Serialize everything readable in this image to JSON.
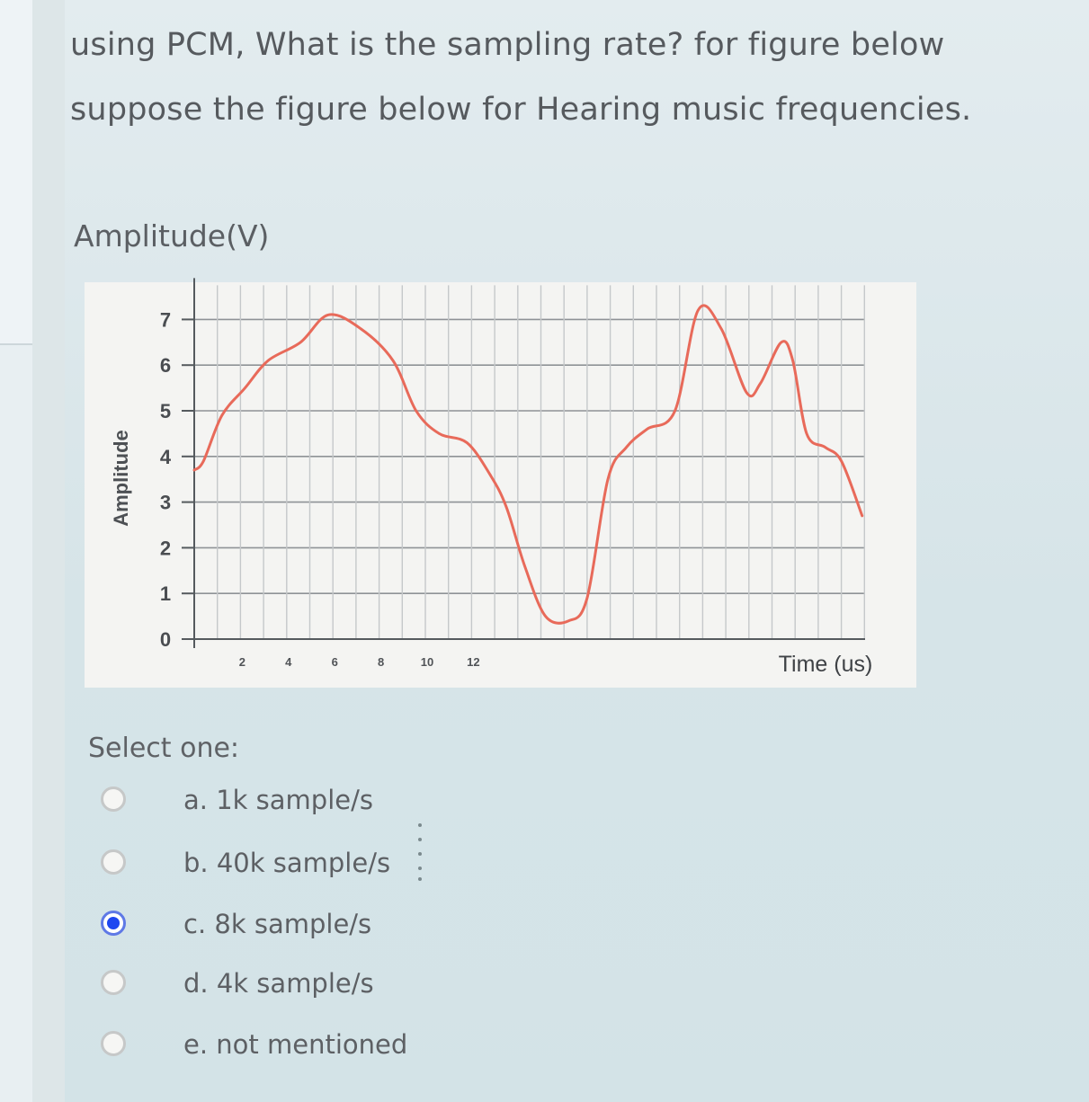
{
  "question": {
    "line1": "using PCM, What is the sampling rate? for figure below",
    "line2": "suppose the figure below for Hearing music frequencies."
  },
  "figure_heading": "Amplitude(V)",
  "chart_data": {
    "type": "line",
    "ylabel": "Amplitude",
    "xlabel": "Time (us)",
    "ylim": [
      0,
      7
    ],
    "y_ticks": [
      0,
      1,
      2,
      3,
      4,
      5,
      6,
      7
    ],
    "x_ticks": [
      "2",
      "4",
      "6",
      "8",
      "10",
      "12"
    ],
    "grid": true,
    "series": [
      {
        "color": "#e86a5a",
        "x": [
          0,
          0.4,
          1.2,
          2.2,
          3.2,
          4.6,
          5.8,
          7.2,
          8.6,
          9.6,
          10.6,
          11.8,
          12.8,
          13.5,
          14.3,
          15.2,
          16.2,
          17.0,
          17.9,
          18.7,
          19.6,
          20.8,
          21.8,
          22.8,
          23.9,
          24.5,
          25.4,
          25.9,
          26.5,
          27.3,
          28.0,
          28.9
        ],
        "y": [
          3.7,
          3.9,
          4.9,
          5.5,
          6.1,
          6.5,
          7.1,
          6.8,
          6.1,
          5.0,
          4.5,
          4.3,
          3.6,
          2.9,
          1.6,
          0.5,
          0.4,
          0.9,
          3.5,
          4.2,
          4.6,
          5.0,
          7.2,
          6.8,
          5.4,
          5.6,
          6.5,
          6.1,
          4.5,
          4.2,
          3.9,
          2.7
        ]
      }
    ]
  },
  "select_one": "Select one:",
  "options": [
    {
      "label": "a. 1k sample/s",
      "selected": false
    },
    {
      "label": "b. 40k sample/s",
      "selected": false
    },
    {
      "label": "c. 8k sample/s",
      "selected": true
    },
    {
      "label": "d. 4k sample/s",
      "selected": false
    },
    {
      "label": "e. not mentioned",
      "selected": false
    }
  ],
  "colors": {
    "selected_radio": "#1e47f0",
    "curve": "#e86a5a"
  }
}
